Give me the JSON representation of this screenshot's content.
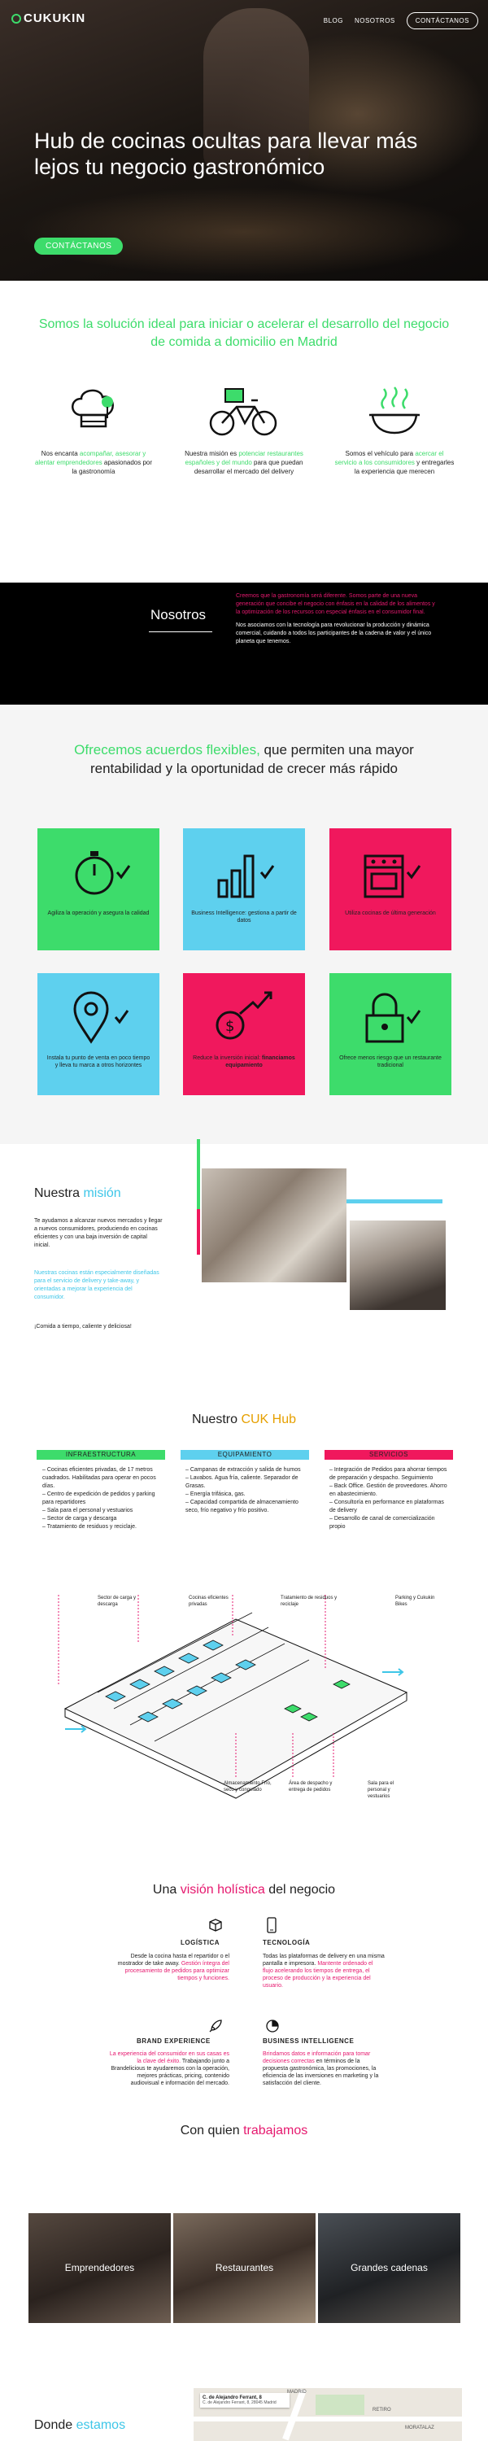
{
  "header": {
    "logo": "CUKUKIN",
    "nav": [
      "BLOG",
      "NOSOTROS"
    ],
    "nav_cta": "CONTÁCTANOS"
  },
  "hero": {
    "title": "Hub de cocinas ocultas para llevar más lejos tu negocio gastronómico",
    "button": "CONTÁCTANOS"
  },
  "intro": {
    "title": "Somos la solución ideal para iniciar o acelerar el desarrollo del negocio de comida a domicilio en Madrid",
    "features": [
      {
        "icon": "chef-hat-icon",
        "pre": "Nos encanta ",
        "hl": "acompañar, asesorar y alentar emprendedores",
        "post": " apasionados por la gastronomía"
      },
      {
        "icon": "bicycle-icon",
        "pre": "Nuestra misión es ",
        "hl": "potenciar restaurantes españoles y del mundo",
        "post": " para que puedan desarrollar el mercado del delivery"
      },
      {
        "icon": "bowl-icon",
        "pre": "Somos el vehículo para ",
        "hl": "acercar el servicio a los consumidores",
        "post": " y entregarles la experiencia que merecen"
      }
    ]
  },
  "nosotros": {
    "title": "Nosotros",
    "p1": "Creemos que la gastronomía será diferente. Somos parte de una nueva generación que concibe el negocio con énfasis en la calidad de los alimentos y la optimización de los recursos con especial énfasis en el consumidor final.",
    "p2": "Nos asociamos con la tecnología para revolucionar la producción y dinámica comercial, cuidando a todos los participantes de la cadena de valor y el único planeta que tenemos."
  },
  "offer": {
    "title_hl": "Ofrecemos acuerdos flexibles,",
    "title_rest": " que permiten una mayor rentabilidad y la oportunidad de crecer más rápido",
    "tiles": [
      {
        "text": "Agiliza la operación y asegura la calidad",
        "color": "#3ddc6b",
        "icon": "stopwatch-icon"
      },
      {
        "text": "Business Intelligence: gestiona a partir de datos",
        "color": "#5ed0ee",
        "icon": "bar-chart-icon"
      },
      {
        "text": "Utiliza cocinas de última generación",
        "color": "#f0185d",
        "icon": "stove-icon"
      },
      {
        "text": "Instala tu punto de venta en poco tiempo y lleva tu marca a otros horizontes",
        "color": "#5ed0ee",
        "icon": "location-pin-icon"
      },
      {
        "text": "Reduce la inversión inicial: ",
        "bold": "financiamos equipamiento",
        "color": "#f0185d",
        "icon": "money-growth-icon"
      },
      {
        "text": "Ofrece menos riesgo que un restaurante tradicional",
        "color": "#3ddc6b",
        "icon": "padlock-icon"
      }
    ]
  },
  "mision": {
    "title": "Nuestra ",
    "title_hl": "misión",
    "p1": "Te ayudamos a alcanzar nuevos mercados y llegar a nuevos consumidores, produciendo en cocinas eficientes y con una baja inversión de capital inicial.",
    "p2": "Nuestras cocinas están especialmente diseñadas para el servicio de delivery y take-away, y orientadas a mejorar la experiencia del consumidor.",
    "p3": "¡Comida a tiempo, caliente y deliciosa!"
  },
  "hub": {
    "title": "Nuestro ",
    "title_hl": "CUK Hub",
    "columns": [
      {
        "head": "INFRAESTRUCTURA",
        "color": "#3ddc6b",
        "items": [
          "Cocinas eficientes privadas, de 17 metros cuadrados. Habilitadas para operar en pocos días.",
          "Centro de expedición de pedidos y parking para repartidores",
          "Sala para el personal y vestuarios",
          "Sector de carga y descarga",
          "Tratamiento de residuos y reciclaje."
        ]
      },
      {
        "head": "EQUIPAMIENTO",
        "color": "#5ed0ee",
        "items": [
          "Campanas de extracción y salida de humos",
          "Lavabos. Agua fría, caliente. Separador de Grasas.",
          "Energía trifásica, gas.",
          "Capacidad compartida de almacenamiento seco, frío negativo y frío positivo."
        ]
      },
      {
        "head": "SERVICIOS",
        "color": "#f0185d",
        "items": [
          "Integración de Pedidos para ahorrar tiempos de preparación y despacho. Seguimiento",
          "Back Office. Gestión de proveedores. Ahorro en abastecimiento.",
          "Consultoría en performance en plataformas de delivery",
          "Desarrollo de canal de comercialización propio"
        ]
      }
    ],
    "labels": {
      "carga": "Sector de carga y descarga",
      "cocinas": "Cocinas eficientes privadas",
      "residuos": "Tratamiento de residuos y reciclaje",
      "parking": "Parking y Cukukin Bikes",
      "almacen": "Almacenamiento Frío, seco y congelado",
      "despacho": "Área de despacho y entrega de pedidos",
      "sala": "Sala para el personal y vestuarios"
    }
  },
  "vision": {
    "title": "Una ",
    "title_hl": "visión holística",
    "title_rest": " del negocio",
    "blocks": [
      {
        "head": "LOGÍSTICA",
        "icon": "box-icon",
        "p_black": "Desde la cocina hasta el repartidor o el mostrador de take away.",
        "p_hl": "Gestión íntegra del procesamiento de pedidos para optimizar tiempos y funciones."
      },
      {
        "head": "TECNOLOGÍA",
        "icon": "phone-icon",
        "p_black": "Todas las plataformas de delivery en una misma pantalla e impresora.",
        "p_hl": "Mantente ordenado el flujo acelerando los tiempos de entrega, el proceso de producción y la experiencia del usuario."
      },
      {
        "head": "BRAND EXPERIENCE",
        "icon": "rocket-icon",
        "p_hl": "La experiencia del consumidor en sus casas es la clave del éxito.",
        "p_black": "Trabajando junto a Brandelicious te ayudaremos con la operación, mejores prácticas, pricing, contenido audiovisual e información del mercado."
      },
      {
        "head": "BUSINESS INTELLIGENCE",
        "icon": "pie-chart-icon",
        "p_hl": "Brindamos datos e información para tomar decisiones correctas",
        "p_black": "en términos de la propuesta gastronómica, las promociones, la eficiencia de las inversiones en marketing y la satisfacción del cliente."
      }
    ]
  },
  "who": {
    "title": "Con quien ",
    "title_hl": "trabajamos",
    "cards": [
      "Emprendedores",
      "Restaurantes",
      "Grandes cadenas"
    ]
  },
  "donde": {
    "title": "Donde ",
    "title_hl": "estamos",
    "map_address": "C. de Alejandro Ferrant, 8",
    "map_lines": [
      "C. de Alejandro Ferrant, 8, 28045 Madrid"
    ],
    "map_labels": [
      "MADRID",
      "RETIRO",
      "MORATALAZ"
    ]
  }
}
